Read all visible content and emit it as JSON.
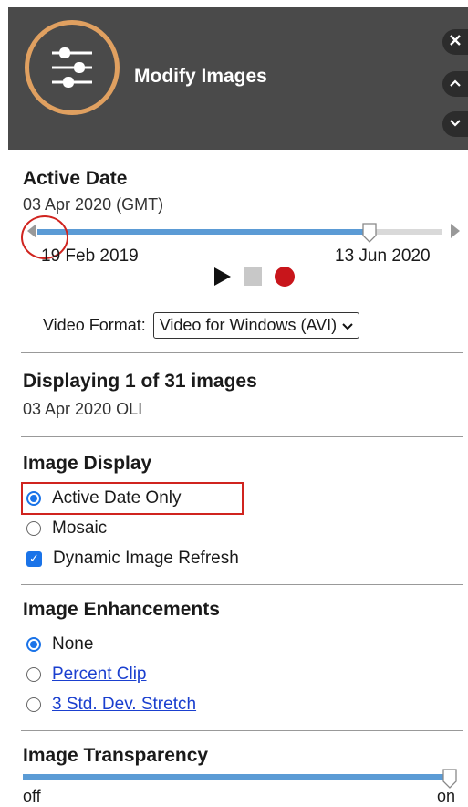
{
  "header": {
    "title": "Modify Images",
    "logo_icon": "sliders-icon",
    "close_label": "✕",
    "up_label": "⌃",
    "down_label": "⌄"
  },
  "active_date": {
    "heading": "Active Date",
    "current": "03 Apr 2020 (GMT)",
    "start_label": "19 Feb 2019",
    "end_label": "13 Jun 2020",
    "slider_position": 0.82
  },
  "playback": {
    "play_icon": "play-icon",
    "stop_icon": "stop-icon",
    "record_icon": "record-icon",
    "video_format_label": "Video Format:",
    "video_format_value": "Video for Windows (AVI)"
  },
  "displaying": {
    "heading": "Displaying 1 of 31 images",
    "detail": "03 Apr 2020 OLI"
  },
  "image_display": {
    "heading": "Image Display",
    "options": [
      {
        "label": "Active Date Only",
        "selected": true
      },
      {
        "label": "Mosaic",
        "selected": false
      }
    ],
    "checkbox_label": "Dynamic Image Refresh",
    "checkbox_checked": true
  },
  "image_enhancements": {
    "heading": "Image Enhancements",
    "options": [
      {
        "label": "None",
        "selected": true,
        "link": false
      },
      {
        "label": "Percent Clip",
        "selected": false,
        "link": true
      },
      {
        "label": "3 Std. Dev. Stretch",
        "selected": false,
        "link": true
      }
    ]
  },
  "image_transparency": {
    "heading": "Image Transparency",
    "min_label": "off",
    "max_label": "on",
    "level": 1.0
  },
  "colors": {
    "header_bg": "#4a4a4a",
    "accent_ring": "#e0a060",
    "slider_blue": "#5b9bd5",
    "highlight_red": "#d0241f",
    "link_blue": "#1a3fcf"
  }
}
